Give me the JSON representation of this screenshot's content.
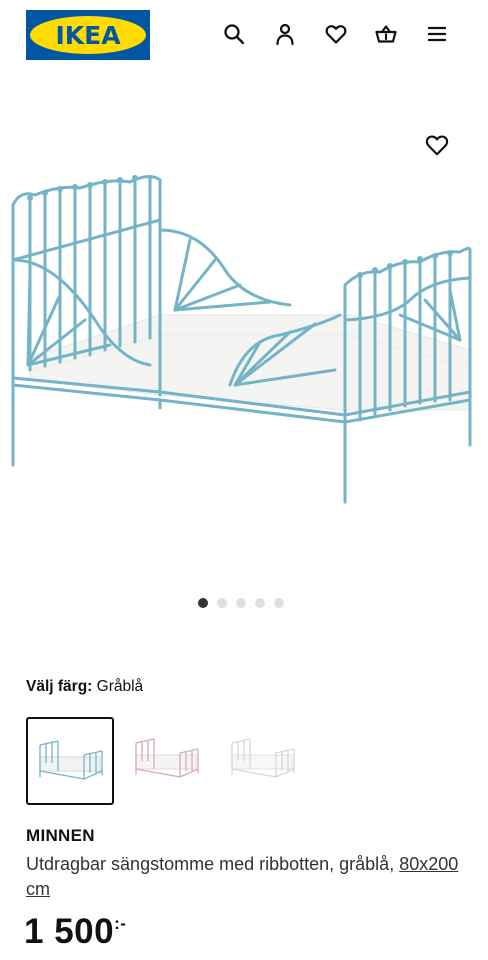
{
  "brand": {
    "logo_text": "IKEA"
  },
  "header": {
    "icons": [
      "search-icon",
      "profile-icon",
      "heart-icon",
      "basket-icon",
      "menu-icon"
    ]
  },
  "gallery": {
    "slides": 5,
    "active_slide": 1
  },
  "color": {
    "label": "Välj färg:",
    "value": "Gråblå",
    "options": [
      "Gråblå",
      "Rosa",
      "Vit"
    ]
  },
  "product": {
    "name": "MINNEN",
    "description": "Utdragbar sängstomme med ribbotten, gråblå, ",
    "size": "80x200 cm",
    "price_main": "1 500",
    "price_suffix": ":-"
  },
  "colors": {
    "brand_blue": "#0058a3",
    "brand_yellow": "#ffdb00",
    "bed_frame": "#74b4c6"
  }
}
